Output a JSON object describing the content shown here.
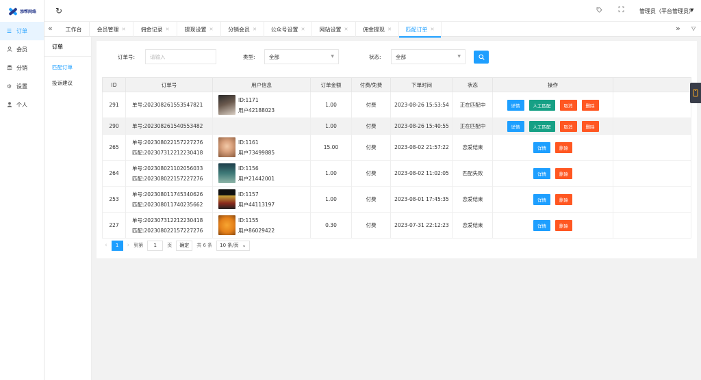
{
  "brand": {
    "name": "添帮网络"
  },
  "colors": {
    "primary": "#1e9fff",
    "green": "#16a085",
    "danger": "#ff5722",
    "alert_text": "#e8101a"
  },
  "nav": {
    "items": [
      {
        "label": "订单",
        "icon": "menu-icon",
        "active": true
      },
      {
        "label": "会员",
        "icon": "user-icon"
      },
      {
        "label": "分销",
        "icon": "database-icon"
      },
      {
        "label": "设置",
        "icon": "gear-icon"
      },
      {
        "label": "个人",
        "icon": "person-icon"
      }
    ]
  },
  "header": {
    "user_label": "管理员（平台管理员）"
  },
  "tabs": [
    {
      "label": "工作台",
      "closable": false
    },
    {
      "label": "会员管理",
      "closable": true
    },
    {
      "label": "佣金记录",
      "closable": true
    },
    {
      "label": "提现设置",
      "closable": true
    },
    {
      "label": "分销会员",
      "closable": true
    },
    {
      "label": "公众号设置",
      "closable": true
    },
    {
      "label": "网站设置",
      "closable": true
    },
    {
      "label": "佣金提现",
      "closable": true
    },
    {
      "label": "匹配订单",
      "closable": true,
      "active": true
    }
  ],
  "subnav": {
    "title": "订单",
    "items": [
      {
        "label": "匹配订单",
        "active": true
      },
      {
        "label": "投诉建议"
      }
    ]
  },
  "filters": {
    "order_no_label": "订单号:",
    "order_no_placeholder": "请输入",
    "type_label": "类型:",
    "type_value": "全部",
    "status_label": "状态:",
    "status_value": "全部"
  },
  "table": {
    "headers": [
      "ID",
      "订单号",
      "用户信息",
      "订单金额",
      "付费/免费",
      "下单时间",
      "状态",
      "操作"
    ],
    "rows": [
      {
        "id": "291",
        "order_line1": "单号:202308261553547821",
        "order_line2": "",
        "user_id": "ID:1171",
        "user_name": "用户42188023",
        "amount": "1.00",
        "pay": "付费",
        "time": "2023-08-26 15:53:54",
        "status": "正在匹配中",
        "status_kind": "active",
        "actions": [
          "详情",
          "人工匹配",
          "取消",
          "删除"
        ]
      },
      {
        "id": "290",
        "order_line1": "单号:202308261540553482",
        "order_line2": "",
        "user_id": "",
        "user_name": "",
        "amount": "1.00",
        "pay": "付费",
        "time": "2023-08-26 15:40:55",
        "status": "正在匹配中",
        "status_kind": "active",
        "actions": [
          "详情",
          "人工匹配",
          "取消",
          "删除"
        ]
      },
      {
        "id": "265",
        "order_line1": "单号:202308022157227276",
        "order_line2": "匹配:202307312212230418",
        "user_id": "ID:1161",
        "user_name": "用户73499885",
        "amount": "15.00",
        "pay": "付费",
        "time": "2023-08-02 21:57:22",
        "status": "恋爱结束",
        "status_kind": "done",
        "actions": [
          "详情",
          "删除"
        ]
      },
      {
        "id": "264",
        "order_line1": "单号:202308021102056033",
        "order_line2": "匹配:202308022157227276",
        "user_id": "ID:1156",
        "user_name": "用户21442001",
        "amount": "1.00",
        "pay": "付费",
        "time": "2023-08-02 11:02:05",
        "status": "匹配失败",
        "status_kind": "done",
        "actions": [
          "详情",
          "删除"
        ]
      },
      {
        "id": "253",
        "order_line1": "单号:202308011745340626",
        "order_line2": "匹配:202308011740235662",
        "user_id": "ID:1157",
        "user_name": "用户44113197",
        "amount": "1.00",
        "pay": "付费",
        "time": "2023-08-01 17:45:35",
        "status": "恋爱结束",
        "status_kind": "done",
        "actions": [
          "详情",
          "删除"
        ]
      },
      {
        "id": "227",
        "order_line1": "单号:202307312212230418",
        "order_line2": "匹配:202308022157227276",
        "user_id": "ID:1155",
        "user_name": "用户86029422",
        "amount": "0.30",
        "pay": "付费",
        "time": "2023-07-31 22:12:23",
        "status": "恋爱结束",
        "status_kind": "done",
        "actions": [
          "详情",
          "删除"
        ]
      }
    ]
  },
  "pagination": {
    "current": "1",
    "goto_label": "到第",
    "goto_value": "1",
    "page_unit": "页",
    "confirm": "确定",
    "total": "共 6 条",
    "per_page": "10 条/页"
  }
}
